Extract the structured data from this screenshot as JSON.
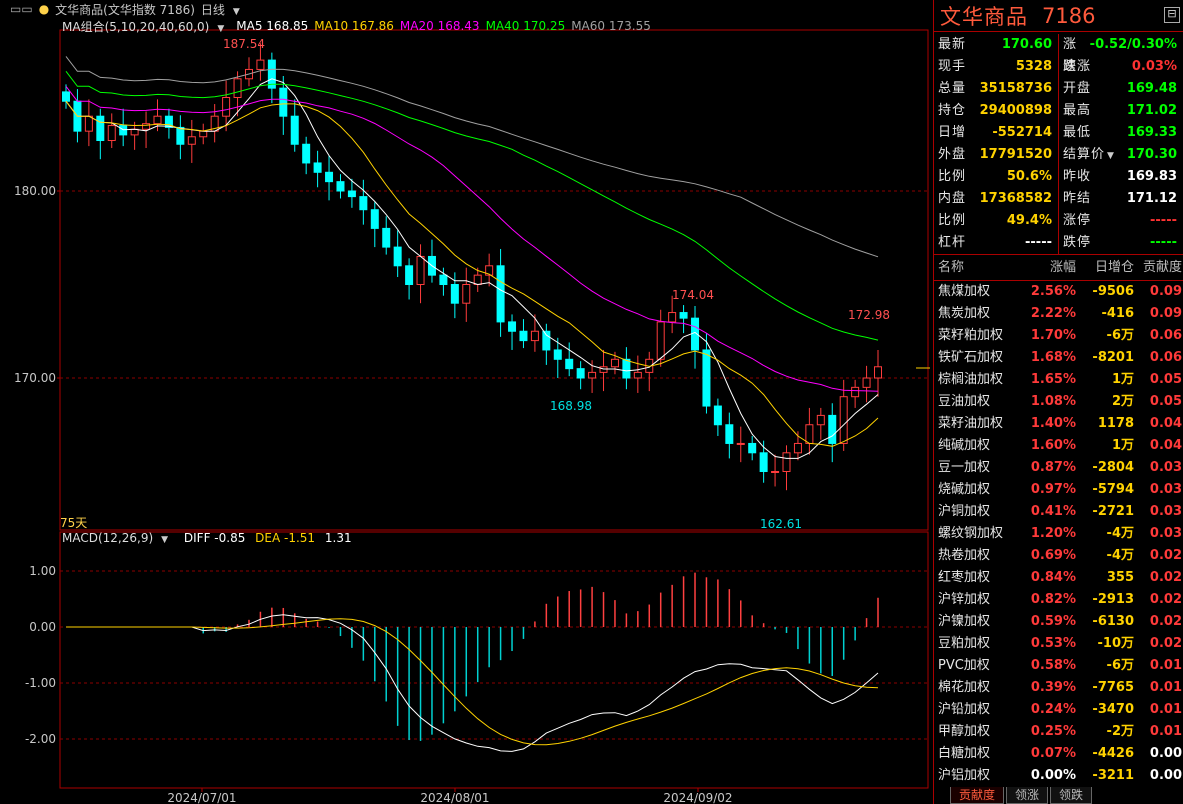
{
  "chart": {
    "period": "日线",
    "instrument_label": "文华商品(文华指数  7186)",
    "ma_combo_label": "MA组合(5,10,20,40,60,0)",
    "ma": [
      {
        "name": "MA5",
        "value": "168.85",
        "color": "#ffffff"
      },
      {
        "name": "MA10",
        "value": "167.86",
        "color": "#ffd200"
      },
      {
        "name": "MA20",
        "value": "168.43",
        "color": "#ff00ff"
      },
      {
        "name": "MA40",
        "value": "170.25",
        "color": "#00ff00"
      },
      {
        "name": "MA60",
        "value": "173.55",
        "color": "#a0a0a0"
      }
    ],
    "y_ticks": [
      "180.00",
      "170.00"
    ],
    "annotations": {
      "high1": "187.54",
      "low1": "168.98",
      "high2": "174.04",
      "high3": "172.98",
      "low2": "162.61"
    },
    "bar_count_label": "75天",
    "x_dates": [
      "2024/07/01",
      "2024/08/01",
      "2024/09/02"
    ],
    "macd": {
      "label": "MACD(12,26,9)",
      "diff_label": "DIFF -0.85",
      "dea_label": "DEA -1.51",
      "macd_value": "1.31",
      "y_ticks": [
        "1.00",
        "0.00",
        "-1.00",
        "-2.00"
      ]
    }
  },
  "chart_data": {
    "type": "candlestick",
    "x": [
      "2024/07/01",
      "2024/08/01",
      "2024/09/02"
    ],
    "price_ticks": [
      180.0,
      170.0
    ],
    "ohlc_close_estimates": [
      184.8,
      183.2,
      184.0,
      182.7,
      183.5,
      183.0,
      183.3,
      183.6,
      184.0,
      183.4,
      182.5,
      182.9,
      183.2,
      184.0,
      185.0,
      186.0,
      186.5,
      187.0,
      185.5,
      184.0,
      182.5,
      181.5,
      181.0,
      180.5,
      180.0,
      179.7,
      179.0,
      178.0,
      177.0,
      176.0,
      175.0,
      176.5,
      175.5,
      175.0,
      174.0,
      175.0,
      175.5,
      176.0,
      173.0,
      172.5,
      172.0,
      172.5,
      171.5,
      171.0,
      170.5,
      170.0,
      170.3,
      170.6,
      171.0,
      170.0,
      170.3,
      171.0,
      173.0,
      173.5,
      173.2,
      171.5,
      168.5,
      167.5,
      166.5,
      166.5,
      166.0,
      165.0,
      165.0,
      166.0,
      166.5,
      167.5,
      168.0,
      166.5,
      169.0,
      169.5,
      170.0,
      170.6
    ],
    "key_levels": {
      "high1": 187.54,
      "low1": 168.98,
      "high2": 174.04,
      "high3": 172.98,
      "low2": 162.61
    },
    "macd": {
      "diff": -0.85,
      "dea": -1.51,
      "macd": 1.31
    }
  },
  "quote": {
    "title": "文华商品",
    "code": "7186",
    "left_rows": [
      {
        "label": "最新",
        "value": "170.60",
        "color": "green"
      },
      {
        "label": "现手",
        "value": "5328",
        "color": "yellow"
      },
      {
        "label": "总量",
        "value": "35158736",
        "color": "yellow"
      },
      {
        "label": "持仓",
        "value": "29400898",
        "color": "yellow"
      },
      {
        "label": "日增",
        "value": "-552714",
        "color": "yellow"
      },
      {
        "label": "外盘",
        "value": "17791520",
        "color": "yellow"
      },
      {
        "label": "比例",
        "value": "50.6%",
        "color": "yellow"
      },
      {
        "label": "内盘",
        "value": "17368582",
        "color": "yellow"
      },
      {
        "label": "比例",
        "value": "49.4%",
        "color": "yellow"
      },
      {
        "label": "杠杆",
        "value": "-----",
        "color": "white"
      }
    ],
    "right_rows": [
      {
        "label": "涨跌",
        "value": "-0.52/0.30%",
        "color": "green"
      },
      {
        "label": "速涨",
        "value": "0.03%",
        "color": "red"
      },
      {
        "label": "开盘",
        "value": "169.48",
        "color": "green"
      },
      {
        "label": "最高",
        "value": "171.02",
        "color": "green"
      },
      {
        "label": "最低",
        "value": "169.33",
        "color": "green"
      },
      {
        "label": "结算价",
        "value": "170.30",
        "color": "green"
      },
      {
        "label": "昨收",
        "value": "169.83",
        "color": "white"
      },
      {
        "label": "昨结",
        "value": "171.12",
        "color": "white"
      },
      {
        "label": "涨停",
        "value": "-----",
        "color": "red"
      },
      {
        "label": "跌停",
        "value": "-----",
        "color": "green"
      }
    ]
  },
  "components": {
    "headers": {
      "name": "名称",
      "change": "涨幅",
      "oi": "日增仓",
      "contribution": "贡献度"
    },
    "rows": [
      {
        "name": "焦煤加权",
        "change": "2.56%",
        "oi": "-9506",
        "contribution": "0.09"
      },
      {
        "name": "焦炭加权",
        "change": "2.22%",
        "oi": "-416",
        "contribution": "0.09"
      },
      {
        "name": "菜籽粕加权",
        "change": "1.70%",
        "oi": "-6万",
        "contribution": "0.06"
      },
      {
        "name": "铁矿石加权",
        "change": "1.68%",
        "oi": "-8201",
        "contribution": "0.06"
      },
      {
        "name": "棕榈油加权",
        "change": "1.65%",
        "oi": "1万",
        "contribution": "0.05"
      },
      {
        "name": "豆油加权",
        "change": "1.08%",
        "oi": "2万",
        "contribution": "0.05"
      },
      {
        "name": "菜籽油加权",
        "change": "1.40%",
        "oi": "1178",
        "contribution": "0.04"
      },
      {
        "name": "纯碱加权",
        "change": "1.60%",
        "oi": "1万",
        "contribution": "0.04"
      },
      {
        "name": "豆一加权",
        "change": "0.87%",
        "oi": "-2804",
        "contribution": "0.03"
      },
      {
        "name": "烧碱加权",
        "change": "0.97%",
        "oi": "-5794",
        "contribution": "0.03"
      },
      {
        "name": "沪铜加权",
        "change": "0.41%",
        "oi": "-2721",
        "contribution": "0.03"
      },
      {
        "name": "螺纹钢加权",
        "change": "1.20%",
        "oi": "-4万",
        "contribution": "0.03"
      },
      {
        "name": "热卷加权",
        "change": "0.69%",
        "oi": "-4万",
        "contribution": "0.02"
      },
      {
        "name": "红枣加权",
        "change": "0.84%",
        "oi": "355",
        "contribution": "0.02"
      },
      {
        "name": "沪锌加权",
        "change": "0.82%",
        "oi": "-2913",
        "contribution": "0.02"
      },
      {
        "name": "沪镍加权",
        "change": "0.59%",
        "oi": "-6130",
        "contribution": "0.02"
      },
      {
        "name": "豆粕加权",
        "change": "0.53%",
        "oi": "-10万",
        "contribution": "0.02"
      },
      {
        "name": "PVC加权",
        "change": "0.58%",
        "oi": "-6万",
        "contribution": "0.01"
      },
      {
        "name": "棉花加权",
        "change": "0.39%",
        "oi": "-7765",
        "contribution": "0.01"
      },
      {
        "name": "沪铅加权",
        "change": "0.24%",
        "oi": "-3470",
        "contribution": "0.01"
      },
      {
        "name": "甲醇加权",
        "change": "0.25%",
        "oi": "-2万",
        "contribution": "0.01"
      },
      {
        "name": "白糖加权",
        "change": "0.07%",
        "oi": "-4426",
        "contribution": "0.00"
      },
      {
        "name": "沪铝加权",
        "change": "0.00%",
        "oi": "-3211",
        "contribution": "0.00"
      }
    ]
  },
  "tabs": [
    "贡献度",
    "领涨",
    "领跌"
  ]
}
